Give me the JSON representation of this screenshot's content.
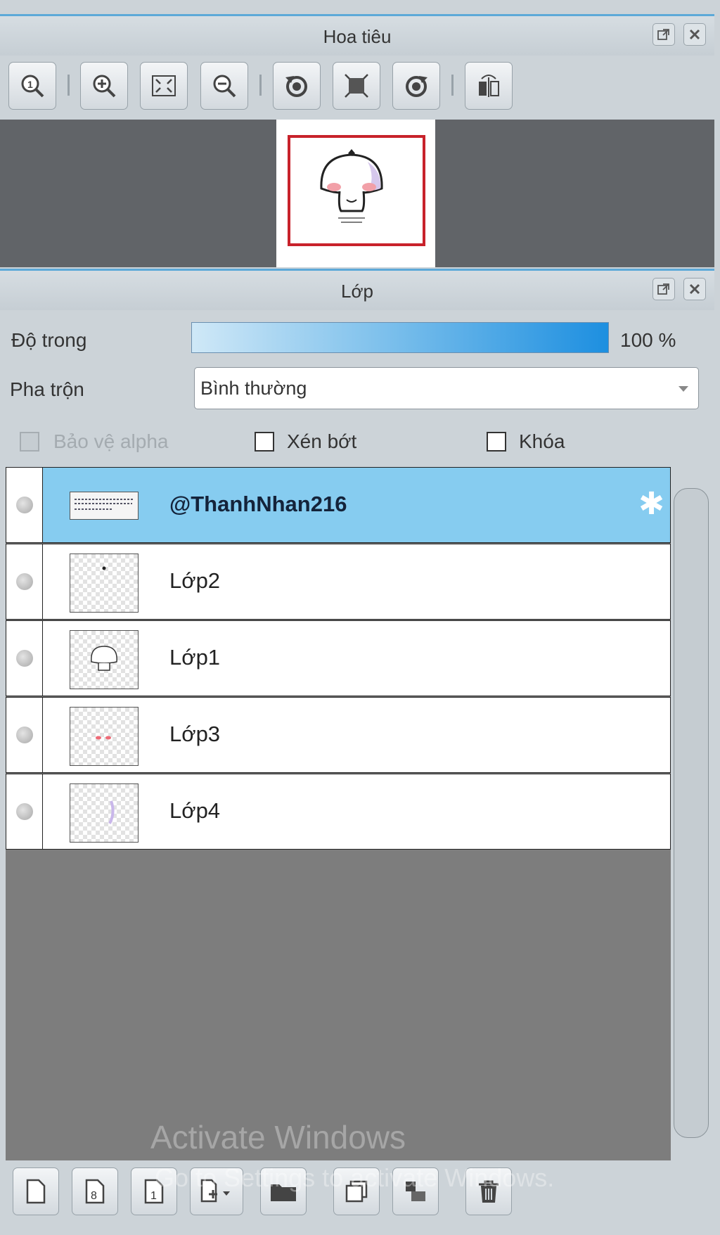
{
  "navigator": {
    "title": "Hoa tiêu",
    "toolbar": [
      {
        "icon": "zoom-actual-icon"
      },
      {
        "icon": "zoom-in-icon"
      },
      {
        "icon": "fit-screen-icon"
      },
      {
        "icon": "zoom-out-icon"
      },
      {
        "icon": "rotate-left-icon"
      },
      {
        "icon": "reset-rotation-icon"
      },
      {
        "icon": "rotate-right-icon"
      },
      {
        "icon": "flip-horizontal-icon"
      }
    ]
  },
  "layers_panel": {
    "title": "Lớp",
    "opacity": {
      "label": "Độ trong",
      "value": "100 %",
      "level": 1.0
    },
    "blend": {
      "label": "Pha trộn",
      "value": "Bình thường"
    },
    "options": {
      "protect_alpha": "Bảo vệ alpha",
      "clipping": "Xén bớt",
      "lock": "Khóa"
    },
    "layers": [
      {
        "name": "@ThanhNhan216",
        "selected": true
      },
      {
        "name": "Lớp2",
        "selected": false
      },
      {
        "name": "Lớp1",
        "selected": false
      },
      {
        "name": "Lớp3",
        "selected": false
      },
      {
        "name": "Lớp4",
        "selected": false
      }
    ]
  },
  "watermark": {
    "line1": "Activate Windows",
    "line2": "Go to Settings to activate Windows."
  },
  "colors": {
    "accent": "#5da9d8",
    "selected_row": "#86ccf0",
    "view_frame": "#c8222b"
  }
}
